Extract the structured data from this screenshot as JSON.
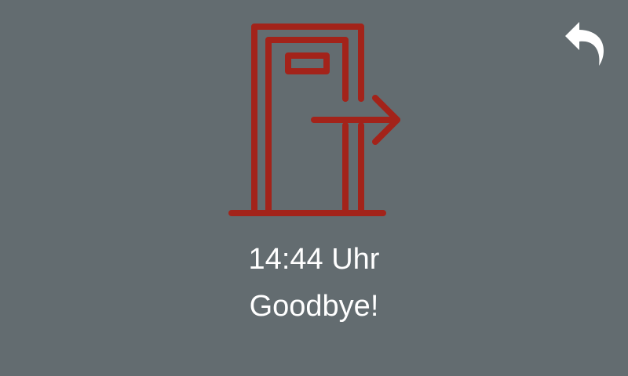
{
  "screen": {
    "background_color": "#636c70",
    "icon_color": "#a3231a",
    "text_color": "#ffffff"
  },
  "icons": {
    "main": "exit-door-icon",
    "back": "back-arrow-icon"
  },
  "status": {
    "time": "14:44 Uhr",
    "message": "Goodbye!"
  }
}
